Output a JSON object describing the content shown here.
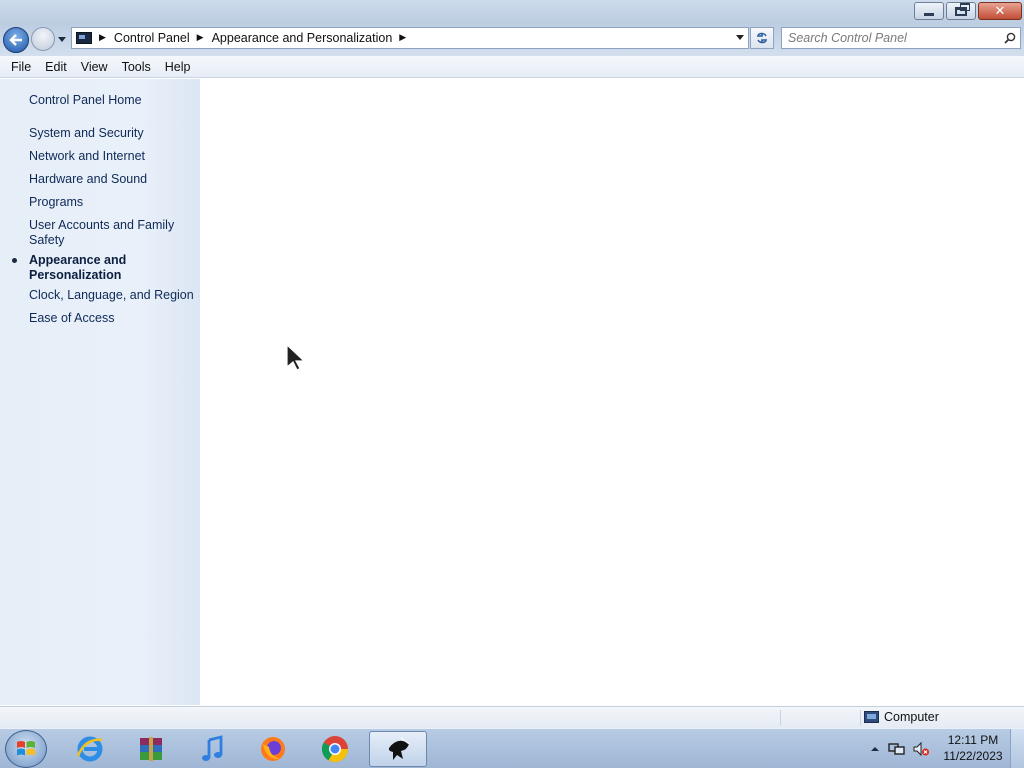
{
  "window": {
    "controls": {
      "minimize": "minimize",
      "maximize": "maximize",
      "close": "✕"
    }
  },
  "address_bar": {
    "crumbs": [
      "Control Panel",
      "Appearance and Personalization"
    ]
  },
  "search": {
    "placeholder": "Search Control Panel"
  },
  "menu": {
    "items": [
      "File",
      "Edit",
      "View",
      "Tools",
      "Help"
    ]
  },
  "sidebar": {
    "home": "Control Panel Home",
    "items": [
      {
        "label": "System and Security"
      },
      {
        "label": "Network and Internet"
      },
      {
        "label": "Hardware and Sound"
      },
      {
        "label": "Programs"
      },
      {
        "label": "User Accounts and Family Safety"
      },
      {
        "label": "Appearance and Personalization",
        "active": true
      },
      {
        "label": "Clock, Language, and Region"
      },
      {
        "label": "Ease of Access"
      }
    ]
  },
  "statusbar": {
    "location": "Computer"
  },
  "taskbar": {
    "apps": [
      {
        "icon": "internet-explorer-icon"
      },
      {
        "icon": "winrar-icon"
      },
      {
        "icon": "itunes-icon"
      },
      {
        "icon": "firefox-icon"
      },
      {
        "icon": "chrome-icon"
      },
      {
        "icon": "inkscape-icon",
        "active": true
      }
    ],
    "time": "12:11 PM",
    "date": "11/22/2023"
  },
  "colors": {
    "link": "#0f2a57",
    "pane_bg": "#e6eef8",
    "taskbar": "#b7cbe4"
  }
}
